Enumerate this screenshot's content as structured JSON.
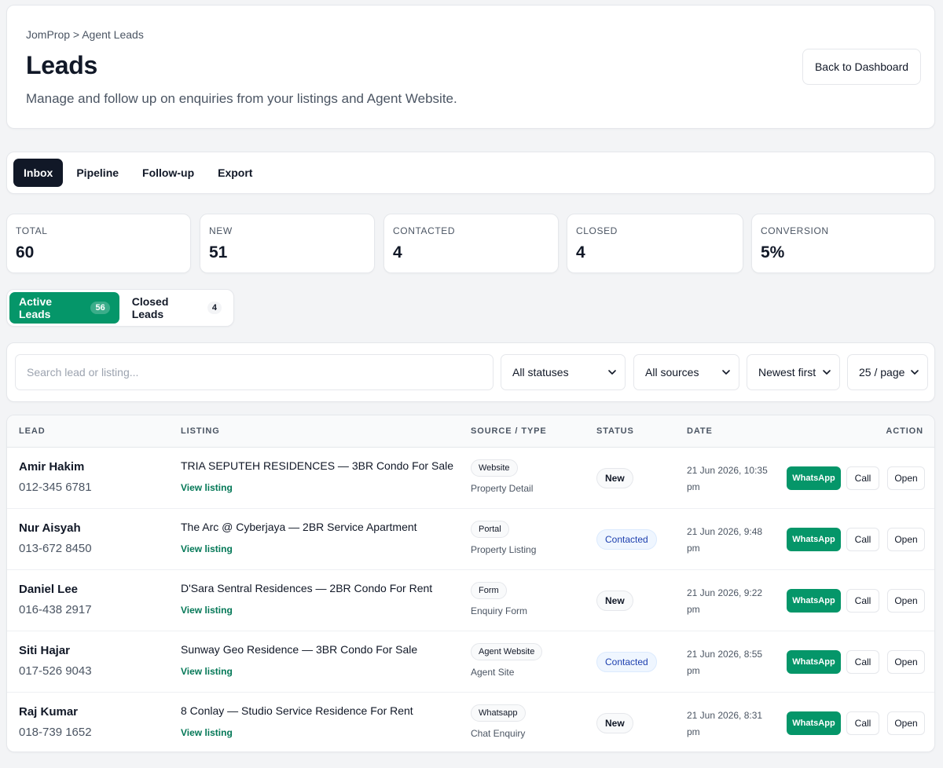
{
  "header": {
    "breadcrumb": "JomProp > Agent Leads",
    "title": "Leads",
    "subtitle": "Manage and follow up on enquiries from your listings and Agent Website.",
    "back_button": "Back to Dashboard"
  },
  "tabs": [
    {
      "label": "Inbox",
      "active": true
    },
    {
      "label": "Pipeline",
      "active": false
    },
    {
      "label": "Follow-up",
      "active": false
    },
    {
      "label": "Export",
      "active": false
    }
  ],
  "stats": [
    {
      "label": "TOTAL",
      "value": "60"
    },
    {
      "label": "NEW",
      "value": "51"
    },
    {
      "label": "CONTACTED",
      "value": "4"
    },
    {
      "label": "CLOSED",
      "value": "4"
    },
    {
      "label": "CONVERSION",
      "value": "5%"
    }
  ],
  "segments": [
    {
      "label": "Active Leads",
      "count": "56",
      "active": true
    },
    {
      "label": "Closed Leads",
      "count": "4",
      "active": false
    }
  ],
  "filters": {
    "search_placeholder": "Search lead or listing...",
    "status": "All statuses",
    "source": "All sources",
    "sort": "Newest first",
    "page_size": "25 / page"
  },
  "table": {
    "headers": {
      "lead": "LEAD",
      "listing": "LISTING",
      "source": "SOURCE / TYPE",
      "status": "STATUS",
      "date": "DATE",
      "action": "ACTION"
    },
    "view_label": "View listing",
    "whatsapp_label": "WhatsApp",
    "call_label": "Call",
    "open_label": "Open",
    "rows": [
      {
        "name": "Amir Hakim",
        "phone": "012-345 6781",
        "listing": "TRIA SEPUTEH RESIDENCES — 3BR Condo For Sale",
        "source": "Website",
        "type": "Property Detail",
        "status": "New",
        "date": "21 Jun 2026, 10:35 pm"
      },
      {
        "name": "Nur Aisyah",
        "phone": "013-672 8450",
        "listing": "The Arc @ Cyberjaya — 2BR Service Apartment",
        "source": "Portal",
        "type": "Property Listing",
        "status": "Contacted",
        "date": "21 Jun 2026, 9:48 pm"
      },
      {
        "name": "Daniel Lee",
        "phone": "016-438 2917",
        "listing": "D'Sara Sentral Residences — 2BR Condo For Rent",
        "source": "Form",
        "type": "Enquiry Form",
        "status": "New",
        "date": "21 Jun 2026, 9:22 pm"
      },
      {
        "name": "Siti Hajar",
        "phone": "017-526 9043",
        "listing": "Sunway Geo Residence — 3BR Condo For Sale",
        "source": "Agent Website",
        "type": "Agent Site",
        "status": "Contacted",
        "date": "21 Jun 2026, 8:55 pm"
      },
      {
        "name": "Raj Kumar",
        "phone": "018-739 1652",
        "listing": "8 Conlay — Studio Service Residence For Rent",
        "source": "Whatsapp",
        "type": "Chat Enquiry",
        "status": "New",
        "date": "21 Jun 2026, 8:31 pm"
      }
    ]
  },
  "colors": {
    "accent_green": "#059669",
    "dark": "#111827",
    "contacted_blue": "#1e40af"
  }
}
